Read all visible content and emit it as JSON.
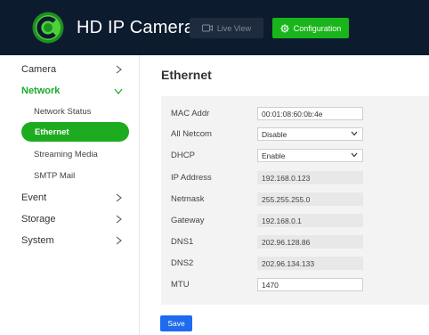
{
  "header": {
    "brand": "HD IP Camera",
    "live_view_label": "Live View",
    "configuration_label": "Configuration",
    "colors": {
      "background": "#0d1b2f",
      "accent": "#19b51b"
    }
  },
  "sidebar": {
    "items": [
      {
        "label": "Camera",
        "icon": "chevron-right-icon"
      },
      {
        "label": "Network",
        "icon": "chevron-down-icon",
        "active": true
      },
      {
        "label": "Event",
        "icon": "chevron-right-icon"
      },
      {
        "label": "Storage",
        "icon": "chevron-right-icon"
      },
      {
        "label": "System",
        "icon": "chevron-right-icon"
      }
    ],
    "network_sub": [
      {
        "label": "Network Status"
      },
      {
        "label": "Ethernet",
        "active": true
      },
      {
        "label": "Streaming Media"
      },
      {
        "label": "SMTP Mail"
      }
    ]
  },
  "main": {
    "title": "Ethernet",
    "fields": [
      {
        "label": "MAC Addr",
        "value": "00:01:08:60:0b:4e",
        "kind": "editable"
      },
      {
        "label": "All Netcom",
        "value": "Disable",
        "kind": "select"
      },
      {
        "label": "DHCP",
        "value": "Enable",
        "kind": "select"
      },
      {
        "label": "IP Address",
        "value": "192.168.0.123",
        "kind": "readonly"
      },
      {
        "label": "Netmask",
        "value": "255.255.255.0",
        "kind": "readonly"
      },
      {
        "label": "Gateway",
        "value": "192.168.0.1",
        "kind": "readonly"
      },
      {
        "label": "DNS1",
        "value": "202.96.128.86",
        "kind": "readonly"
      },
      {
        "label": "DNS2",
        "value": "202.96.134.133",
        "kind": "readonly"
      },
      {
        "label": "MTU",
        "value": "1470",
        "kind": "editable"
      }
    ],
    "save_label": "Save"
  }
}
